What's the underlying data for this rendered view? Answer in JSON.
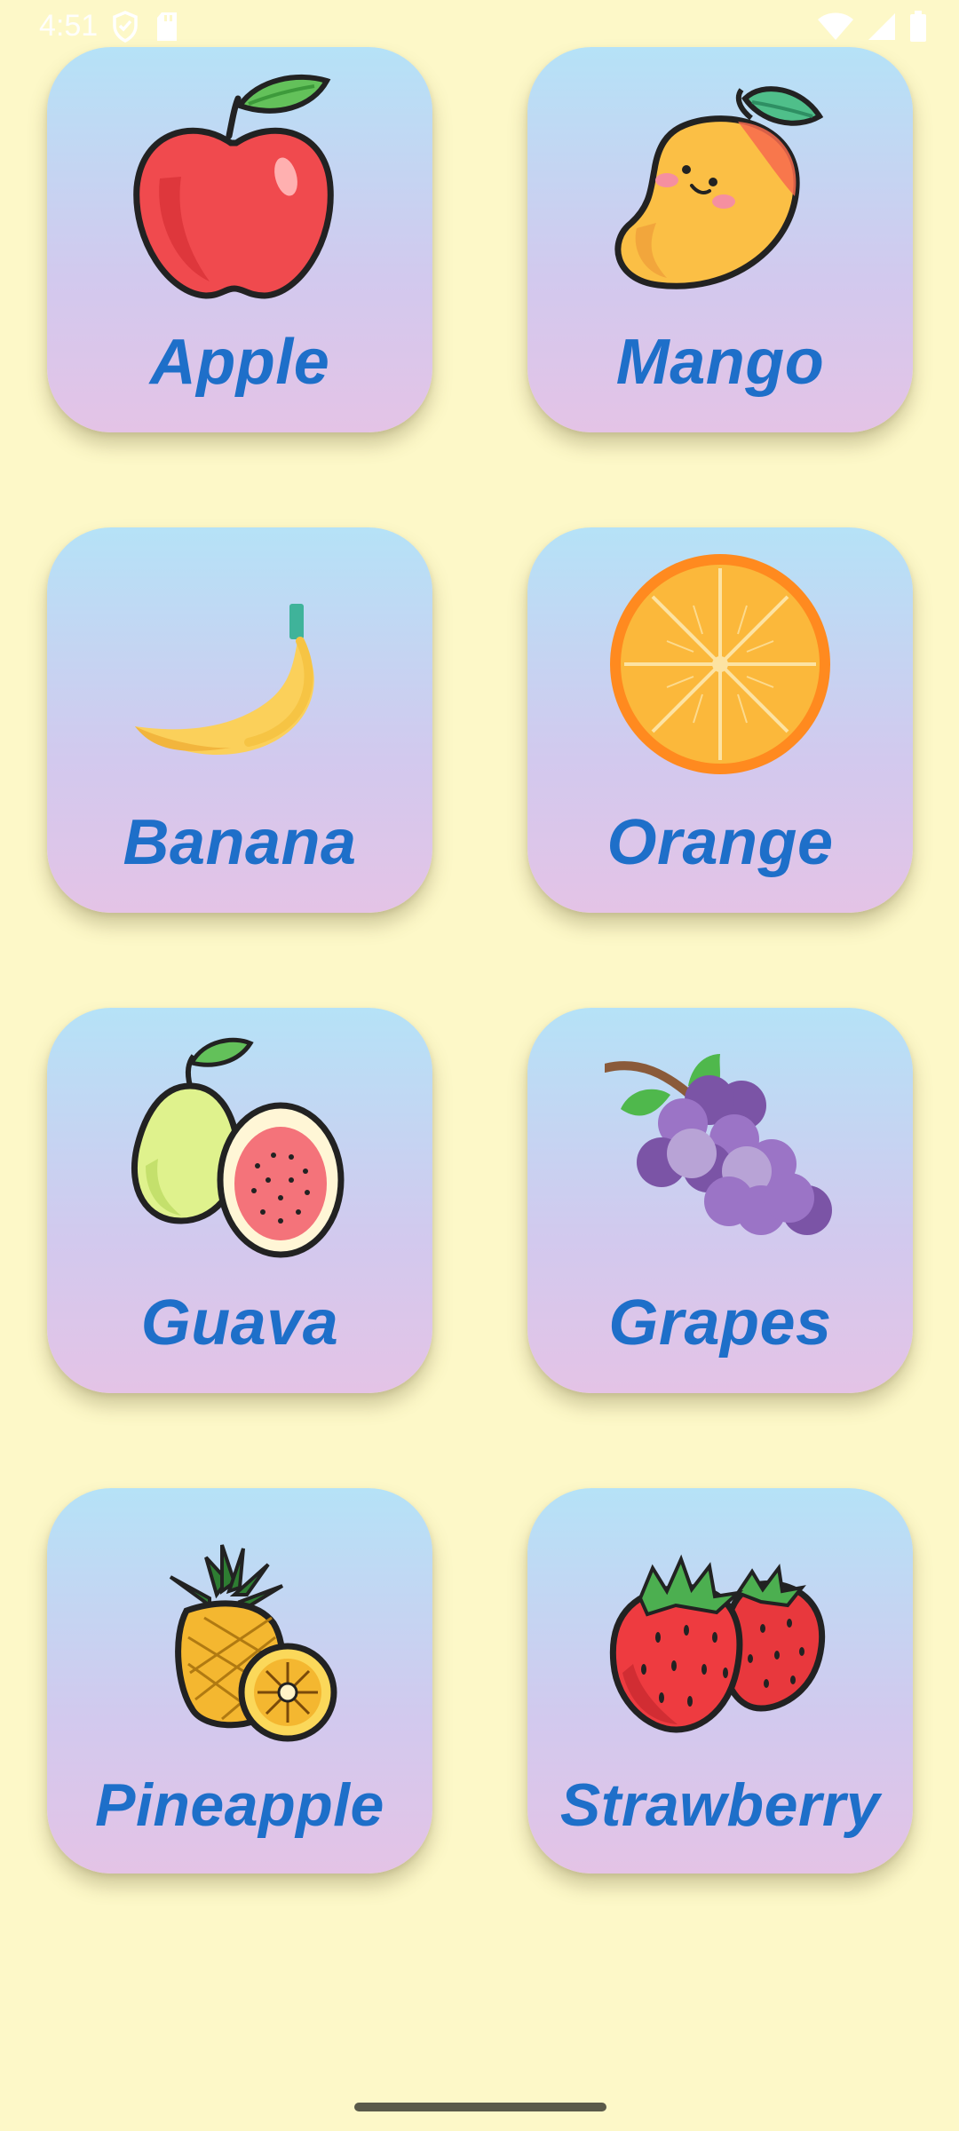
{
  "status_bar": {
    "time": "4:51",
    "left_icons": [
      "shield-icon",
      "sd-card-icon"
    ],
    "right_icons": [
      "wifi-icon",
      "cell-signal-icon",
      "battery-icon"
    ]
  },
  "fruits": [
    {
      "label": "Apple",
      "icon": "apple-icon"
    },
    {
      "label": "Mango",
      "icon": "mango-icon"
    },
    {
      "label": "Banana",
      "icon": "banana-icon"
    },
    {
      "label": "Orange",
      "icon": "orange-icon"
    },
    {
      "label": "Guava",
      "icon": "guava-icon"
    },
    {
      "label": "Grapes",
      "icon": "grapes-icon"
    },
    {
      "label": "Pineapple",
      "icon": "pineapple-icon"
    },
    {
      "label": "Strawberry",
      "icon": "strawberry-icon"
    }
  ],
  "colors": {
    "background": "#fdf8c8",
    "label": "#1e6fc9",
    "card_top": "#b5e2f7",
    "card_bottom": "#e4c3e6"
  }
}
